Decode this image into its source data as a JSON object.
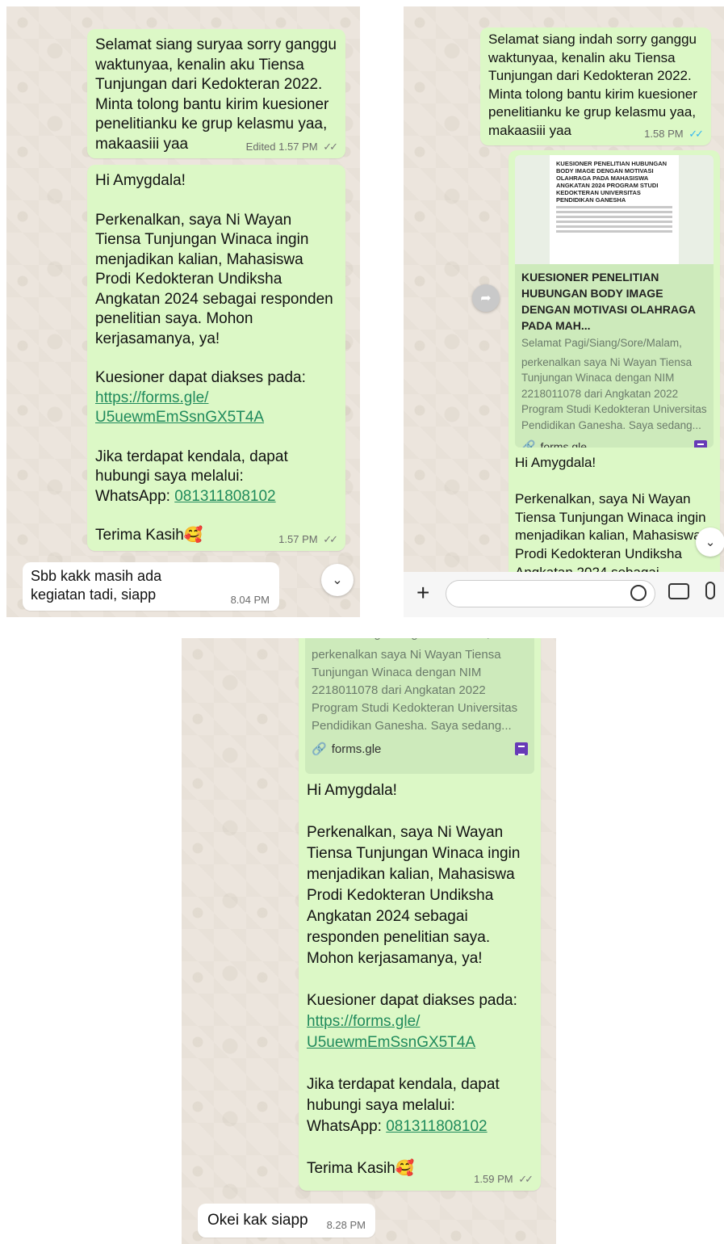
{
  "panel1": {
    "msg1": {
      "text": "Selamat siang suryaa sorry ganggu waktunyaa, kenalin aku Tiensa Tunjungan dari Kedokteran 2022. Minta tolong bantu kirim kuesioner penelitianku ke grup kelasmu yaa, makaasiii yaa",
      "edited": "Edited",
      "time": "1.57 PM"
    },
    "msg2": {
      "greeting": "Hi Amygdala!",
      "intro": "Perkenalkan, saya Ni Wayan Tiensa Tunjungan Winaca ingin menjadikan kalian, Mahasiswa Prodi Kedokteran Undiksha Angkatan 2024 sebagai responden penelitian saya. Mohon kerjasamanya, ya!",
      "access": "Kuesioner dapat diakses pada:",
      "link1": "https://forms.gle/",
      "link2": "U5uewmEmSsnGX5T4A",
      "contact": "Jika terdapat kendala, dapat hubungi saya melalui:",
      "wa_label": "WhatsApp: ",
      "wa_number": "081311808102",
      "thanks": "Terima Kasih",
      "emoji": "🥰",
      "time": "1.57 PM"
    },
    "reply": {
      "text": "Sbb kakk masih ada kegiatan tadi, siapp",
      "time": "8.04 PM"
    }
  },
  "panel2": {
    "msg1": {
      "text": "Selamat siang indah sorry ganggu waktunyaa, kenalin aku Tiensa Tunjungan dari Kedokteran 2022. Minta tolong bantu kirim kuesioner penelitianku ke grup kelasmu yaa, makaasiii yaa",
      "time": "1.58 PM"
    },
    "preview": {
      "doc_title": "KUESIONER PENELITIAN HUBUNGAN BODY IMAGE DENGAN MOTIVASI OLAHRAGA PADA MAHASISWA ANGKATAN 2024 PROGRAM STUDI KEDOKTERAN UNIVERSITAS PENDIDIKAN GANESHA",
      "title": "KUESIONER PENELITIAN HUBUNGAN BODY IMAGE DENGAN MOTIVASI OLAHRAGA PADA MAH...",
      "desc1": "Selamat Pagi/Siang/Sore/Malam,",
      "desc2": "perkenalkan saya Ni Wayan Tiensa Tunjungan Winaca dengan NIM 2218011078 dari Angkatan 2022 Program Studi Kedokteran Universitas Pendidikan Ganesha. Saya sedang...",
      "site": "forms.gle"
    },
    "msg2": {
      "greeting": "Hi Amygdala!",
      "intro": "Perkenalkan, saya Ni Wayan Tiensa Tunjungan Winaca ingin menjadikan kalian, Mahasiswa Prodi Kedokteran Undiksha Angkatan 2024 sebagai"
    }
  },
  "panel3": {
    "preview": {
      "desc1": "Selamat Pagi/Siang/Sore/Malam,",
      "desc2": "perkenalkan saya Ni Wayan Tiensa Tunjungan Winaca dengan NIM 2218011078 dari Angkatan 2022 Program Studi Kedokteran Universitas Pendidikan Ganesha. Saya sedang...",
      "site": "forms.gle"
    },
    "msg": {
      "greeting": "Hi Amygdala!",
      "intro": "Perkenalkan, saya Ni Wayan Tiensa Tunjungan Winaca ingin menjadikan kalian, Mahasiswa Prodi Kedokteran Undiksha Angkatan 2024 sebagai responden penelitian saya. Mohon kerjasamanya, ya!",
      "access": "Kuesioner dapat diakses pada:",
      "link1": "https://forms.gle/",
      "link2": "U5uewmEmSsnGX5T4A",
      "contact": "Jika terdapat kendala, dapat hubungi saya melalui:",
      "wa_label": "WhatsApp: ",
      "wa_number": "081311808102",
      "thanks": "Terima Kasih",
      "emoji": "🥰",
      "time": "1.59 PM"
    },
    "reply": {
      "text": "Okei kak siapp",
      "time": "8.28 PM"
    }
  },
  "colors": {
    "outgoing": "#dcf8c6",
    "incoming": "#ffffff",
    "link": "#1f8a5c",
    "read_ticks": "#34b7f1",
    "forms": "#673ab7"
  },
  "icons": [
    "double-check-icon",
    "chevron-down-icon",
    "forward-icon",
    "link-icon",
    "google-forms-icon",
    "plus-icon",
    "sticker-icon",
    "camera-icon",
    "microphone-icon"
  ]
}
